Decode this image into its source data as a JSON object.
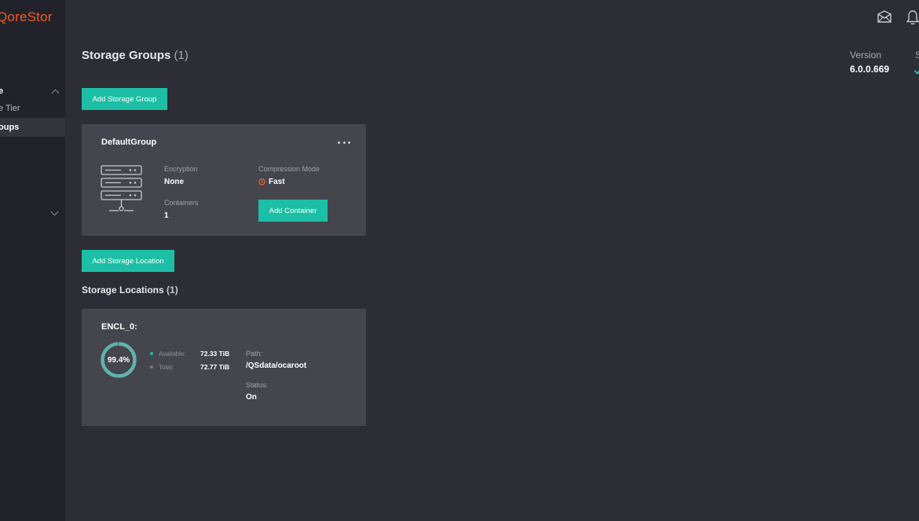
{
  "app": {
    "logo": "QoreStor"
  },
  "sidebar": {
    "items": [
      {
        "label": "e"
      },
      {
        "label": "e Tier"
      },
      {
        "label": "oups"
      }
    ]
  },
  "header": {
    "title": "Storage Groups",
    "count": "(1)",
    "version_label": "Version",
    "version_value": "6.0.0.669",
    "status_label": "S"
  },
  "storage_groups": {
    "add_button": "Add Storage Group",
    "group": {
      "name": "DefaultGroup",
      "encryption_label": "Encryption",
      "encryption_value": "None",
      "compression_label": "Compression Mode",
      "compression_value": "Fast",
      "containers_label": "Containers",
      "containers_value": "1",
      "add_container_button": "Add Container"
    }
  },
  "storage_locations": {
    "add_button": "Add Storage Location",
    "title": "Storage Locations",
    "count": "(1)",
    "location": {
      "name": "ENCL_0:",
      "usage_percent": "99.4%",
      "usage_fraction": 0.994,
      "available_label": "Available:",
      "available_value": "72.33 TiB",
      "total_label": "Total:",
      "total_value": "72.77 TiB",
      "path_label": "Path:",
      "path_value": "/QSdata/ocaroot",
      "status_label": "Status:",
      "status_value": "On"
    }
  },
  "colors": {
    "accent": "#1cbfa5",
    "brand": "#f05a28",
    "warning": "#f0643c",
    "available_dot": "#1cbfa5",
    "total_dot": "#7d7e85"
  },
  "icons": {
    "topbar": [
      "mail-icon",
      "bell-icon"
    ],
    "group": "server-icon",
    "compression": "clock-icon"
  }
}
